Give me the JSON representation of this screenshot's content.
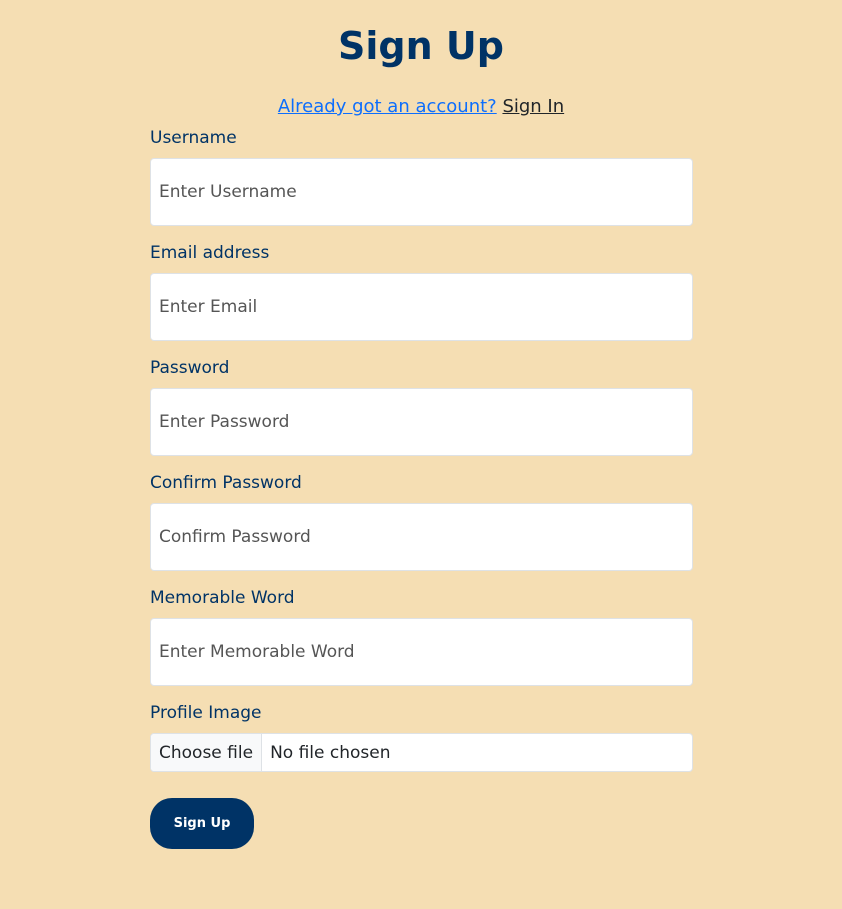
{
  "title": "Sign Up",
  "signin_prompt": {
    "question": "Already got an account?",
    "link": "Sign In"
  },
  "fields": [
    {
      "label": "Username",
      "placeholder": "Enter Username",
      "value": ""
    },
    {
      "label": "Email address",
      "placeholder": "Enter Email",
      "value": ""
    },
    {
      "label": "Password",
      "placeholder": "Enter Password",
      "value": ""
    },
    {
      "label": "Confirm Password",
      "placeholder": "Confirm Password",
      "value": ""
    },
    {
      "label": "Memorable Word",
      "placeholder": "Enter Memorable Word",
      "value": ""
    }
  ],
  "profile_image": {
    "label": "Profile Image",
    "button": "Choose file",
    "status": "No file chosen"
  },
  "submit_label": "Sign Up",
  "colors": {
    "background": "#f5deb3",
    "primary": "#003366",
    "link": "#0d6efd"
  }
}
